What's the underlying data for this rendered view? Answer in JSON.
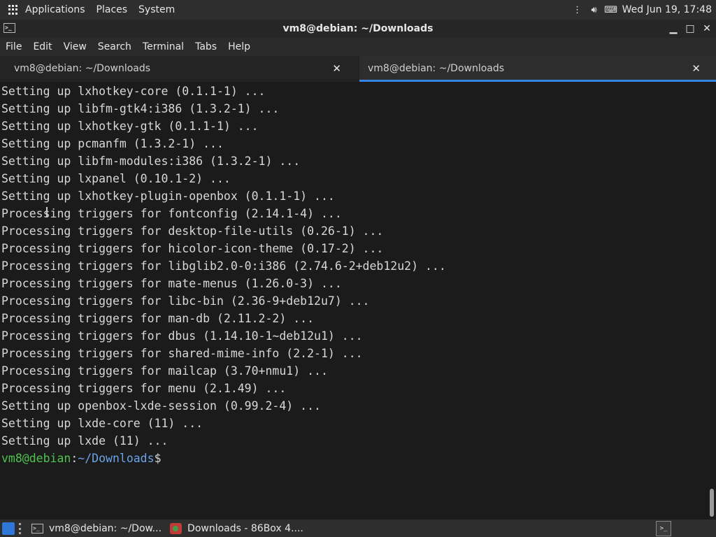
{
  "top_panel": {
    "menus": [
      "Applications",
      "Places",
      "System"
    ],
    "clock": "Wed Jun 19, 17:48"
  },
  "window": {
    "title": "vm8@debian: ~/Downloads",
    "menubar": [
      "File",
      "Edit",
      "View",
      "Search",
      "Terminal",
      "Tabs",
      "Help"
    ],
    "tabs": [
      {
        "label": "vm8@debian: ~/Downloads",
        "active": false
      },
      {
        "label": "vm8@debian: ~/Downloads",
        "active": true
      }
    ]
  },
  "terminal": {
    "lines": [
      "Setting up lxhotkey-core (0.1.1-1) ...",
      "Setting up libfm-gtk4:i386 (1.3.2-1) ...",
      "Setting up lxhotkey-gtk (0.1.1-1) ...",
      "Setting up pcmanfm (1.3.2-1) ...",
      "Setting up libfm-modules:i386 (1.3.2-1) ...",
      "Setting up lxpanel (0.10.1-2) ...",
      "Setting up lxhotkey-plugin-openbox (0.1.1-1) ...",
      "Processing triggers for fontconfig (2.14.1-4) ...",
      "Processing triggers for desktop-file-utils (0.26-1) ...",
      "Processing triggers for hicolor-icon-theme (0.17-2) ...",
      "Processing triggers for libglib2.0-0:i386 (2.74.6-2+deb12u2) ...",
      "Processing triggers for mate-menus (1.26.0-3) ...",
      "Processing triggers for libc-bin (2.36-9+deb12u7) ...",
      "Processing triggers for man-db (2.11.2-2) ...",
      "Processing triggers for dbus (1.14.10-1~deb12u1) ...",
      "Processing triggers for shared-mime-info (2.2-1) ...",
      "Processing triggers for mailcap (3.70+nmu1) ...",
      "Processing triggers for menu (2.1.49) ...",
      "Setting up openbox-lxde-session (0.99.2-4) ...",
      "Setting up lxde-core (11) ...",
      "Setting up lxde (11) ..."
    ],
    "prompt_user": "vm8@debian",
    "prompt_sep": ":",
    "prompt_path": "~/Downloads",
    "prompt_symbol": "$"
  },
  "taskbar": {
    "items": [
      {
        "label": "vm8@debian: ~/Dow...",
        "icon": "terminal-icon"
      },
      {
        "label": "Downloads - 86Box 4....",
        "icon": "86box-icon"
      }
    ]
  }
}
